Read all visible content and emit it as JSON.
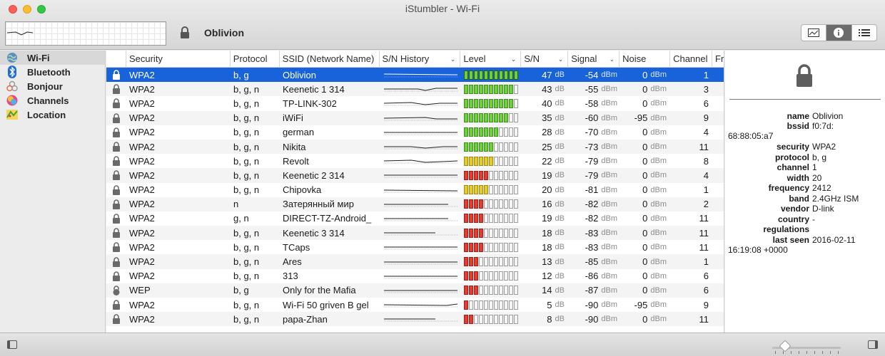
{
  "window": {
    "title": "iStumbler - Wi-Fi"
  },
  "toolbar": {
    "selected_ssid": "Oblivion",
    "view_buttons": [
      "graph-view-icon",
      "info-icon",
      "list-view-icon"
    ]
  },
  "sidebar": {
    "items": [
      {
        "label": "Wi-Fi",
        "icon": "wifi-globe-icon",
        "selected": true
      },
      {
        "label": "Bluetooth",
        "icon": "bluetooth-icon"
      },
      {
        "label": "Bonjour",
        "icon": "bonjour-icon"
      },
      {
        "label": "Channels",
        "icon": "channels-icon"
      },
      {
        "label": "Location",
        "icon": "location-map-icon"
      }
    ]
  },
  "table": {
    "columns": [
      "",
      "Security",
      "Protocol",
      "SSID (Network Name)",
      "S/N History",
      "Level",
      "S/N",
      "Signal",
      "Noise",
      "Channel",
      "Fr"
    ],
    "units": {
      "sn": "dB",
      "signal": "dBm",
      "noise": "dBm"
    },
    "rows": [
      {
        "lock": "lock-icon",
        "security": "WPA2",
        "protocol": "b, g",
        "ssid": "Oblivion",
        "sn": "47",
        "signal": "-54",
        "noise": "0",
        "channel": "1",
        "level": 11,
        "color": "g",
        "selected": true
      },
      {
        "lock": "lock-icon",
        "security": "WPA2",
        "protocol": "b, g, n",
        "ssid": "Keenetic  1 314",
        "sn": "43",
        "signal": "-55",
        "noise": "0",
        "channel": "3",
        "level": 10,
        "color": "g"
      },
      {
        "lock": "lock-icon",
        "security": "WPA2",
        "protocol": "b, g, n",
        "ssid": "TP-LINK-302",
        "sn": "40",
        "signal": "-58",
        "noise": "0",
        "channel": "6",
        "level": 10,
        "color": "g"
      },
      {
        "lock": "lock-icon",
        "security": "WPA2",
        "protocol": "b, g, n",
        "ssid": "iWiFi",
        "sn": "35",
        "signal": "-60",
        "noise": "-95",
        "channel": "9",
        "level": 9,
        "color": "g"
      },
      {
        "lock": "lock-icon",
        "security": "WPA2",
        "protocol": "b, g, n",
        "ssid": "german",
        "sn": "28",
        "signal": "-70",
        "noise": "0",
        "channel": "4",
        "level": 7,
        "color": "g"
      },
      {
        "lock": "lock-icon",
        "security": "WPA2",
        "protocol": "b, g, n",
        "ssid": "Nikita",
        "sn": "25",
        "signal": "-73",
        "noise": "0",
        "channel": "11",
        "level": 6,
        "color": "g"
      },
      {
        "lock": "lock-icon",
        "security": "WPA2",
        "protocol": "b, g, n",
        "ssid": "Revolt",
        "sn": "22",
        "signal": "-79",
        "noise": "0",
        "channel": "8",
        "level": 6,
        "color": "y"
      },
      {
        "lock": "lock-icon",
        "security": "WPA2",
        "protocol": "b, g, n",
        "ssid": "Keenetic 2 314",
        "sn": "19",
        "signal": "-79",
        "noise": "0",
        "channel": "4",
        "level": 5,
        "color": "r"
      },
      {
        "lock": "lock-icon",
        "security": "WPA2",
        "protocol": "b, g, n",
        "ssid": "Chipovka",
        "sn": "20",
        "signal": "-81",
        "noise": "0",
        "channel": "1",
        "level": 5,
        "color": "y"
      },
      {
        "lock": "lock-icon",
        "security": "WPA2",
        "protocol": "n",
        "ssid": "Затерянный мир",
        "sn": "16",
        "signal": "-82",
        "noise": "0",
        "channel": "2",
        "level": 4,
        "color": "r"
      },
      {
        "lock": "lock-icon",
        "security": "WPA2",
        "protocol": "g, n",
        "ssid": "DIRECT-TZ-Android_",
        "sn": "19",
        "signal": "-82",
        "noise": "0",
        "channel": "11",
        "level": 4,
        "color": "r"
      },
      {
        "lock": "lock-icon",
        "security": "WPA2",
        "protocol": "b, g, n",
        "ssid": "Keenetic 3 314",
        "sn": "18",
        "signal": "-83",
        "noise": "0",
        "channel": "11",
        "level": 4,
        "color": "r"
      },
      {
        "lock": "lock-icon",
        "security": "WPA2",
        "protocol": "b, g, n",
        "ssid": "TCaps",
        "sn": "18",
        "signal": "-83",
        "noise": "0",
        "channel": "11",
        "level": 4,
        "color": "r"
      },
      {
        "lock": "lock-icon",
        "security": "WPA2",
        "protocol": "b, g, n",
        "ssid": "Ares",
        "sn": "13",
        "signal": "-85",
        "noise": "0",
        "channel": "1",
        "level": 3,
        "color": "r"
      },
      {
        "lock": "lock-icon",
        "security": "WPA2",
        "protocol": "b, g, n",
        "ssid": "313",
        "sn": "12",
        "signal": "-86",
        "noise": "0",
        "channel": "6",
        "level": 3,
        "color": "r"
      },
      {
        "lock": "wep-lock-icon",
        "security": "WEP",
        "protocol": "b, g",
        "ssid": "Only for the Mafia",
        "sn": "14",
        "signal": "-87",
        "noise": "0",
        "channel": "6",
        "level": 3,
        "color": "r"
      },
      {
        "lock": "lock-icon",
        "security": "WPA2",
        "protocol": "b, g, n",
        "ssid": "Wi-Fi 50 griven B gel",
        "sn": "5",
        "signal": "-90",
        "noise": "-95",
        "channel": "9",
        "level": 1,
        "color": "r"
      },
      {
        "lock": "lock-icon",
        "security": "WPA2",
        "protocol": "b, g, n",
        "ssid": "papa-Zhan",
        "sn": "8",
        "signal": "-90",
        "noise": "0",
        "channel": "11",
        "level": 2,
        "color": "r"
      }
    ]
  },
  "detail": {
    "name": {
      "key": "name",
      "value": "Oblivion"
    },
    "bssid": {
      "key": "bssid",
      "value": "f0:7d:",
      "value_cont": "68:88:05:a7"
    },
    "fields": [
      {
        "key": "security",
        "value": "WPA2"
      },
      {
        "key": "protocol",
        "value": "b, g"
      },
      {
        "key": "channel",
        "value": "1"
      },
      {
        "key": "width",
        "value": "20"
      },
      {
        "key": "frequency",
        "value": "2412"
      },
      {
        "key": "band",
        "value": "2.4GHz ISM"
      },
      {
        "key": "vendor",
        "value": "D-link"
      },
      {
        "key": "country",
        "value": "-"
      },
      {
        "key": "regulations",
        "value": ""
      }
    ],
    "last_seen": {
      "key": "last seen",
      "value": "2016-02-11",
      "value_cont": "16:19:08 +0000"
    }
  }
}
